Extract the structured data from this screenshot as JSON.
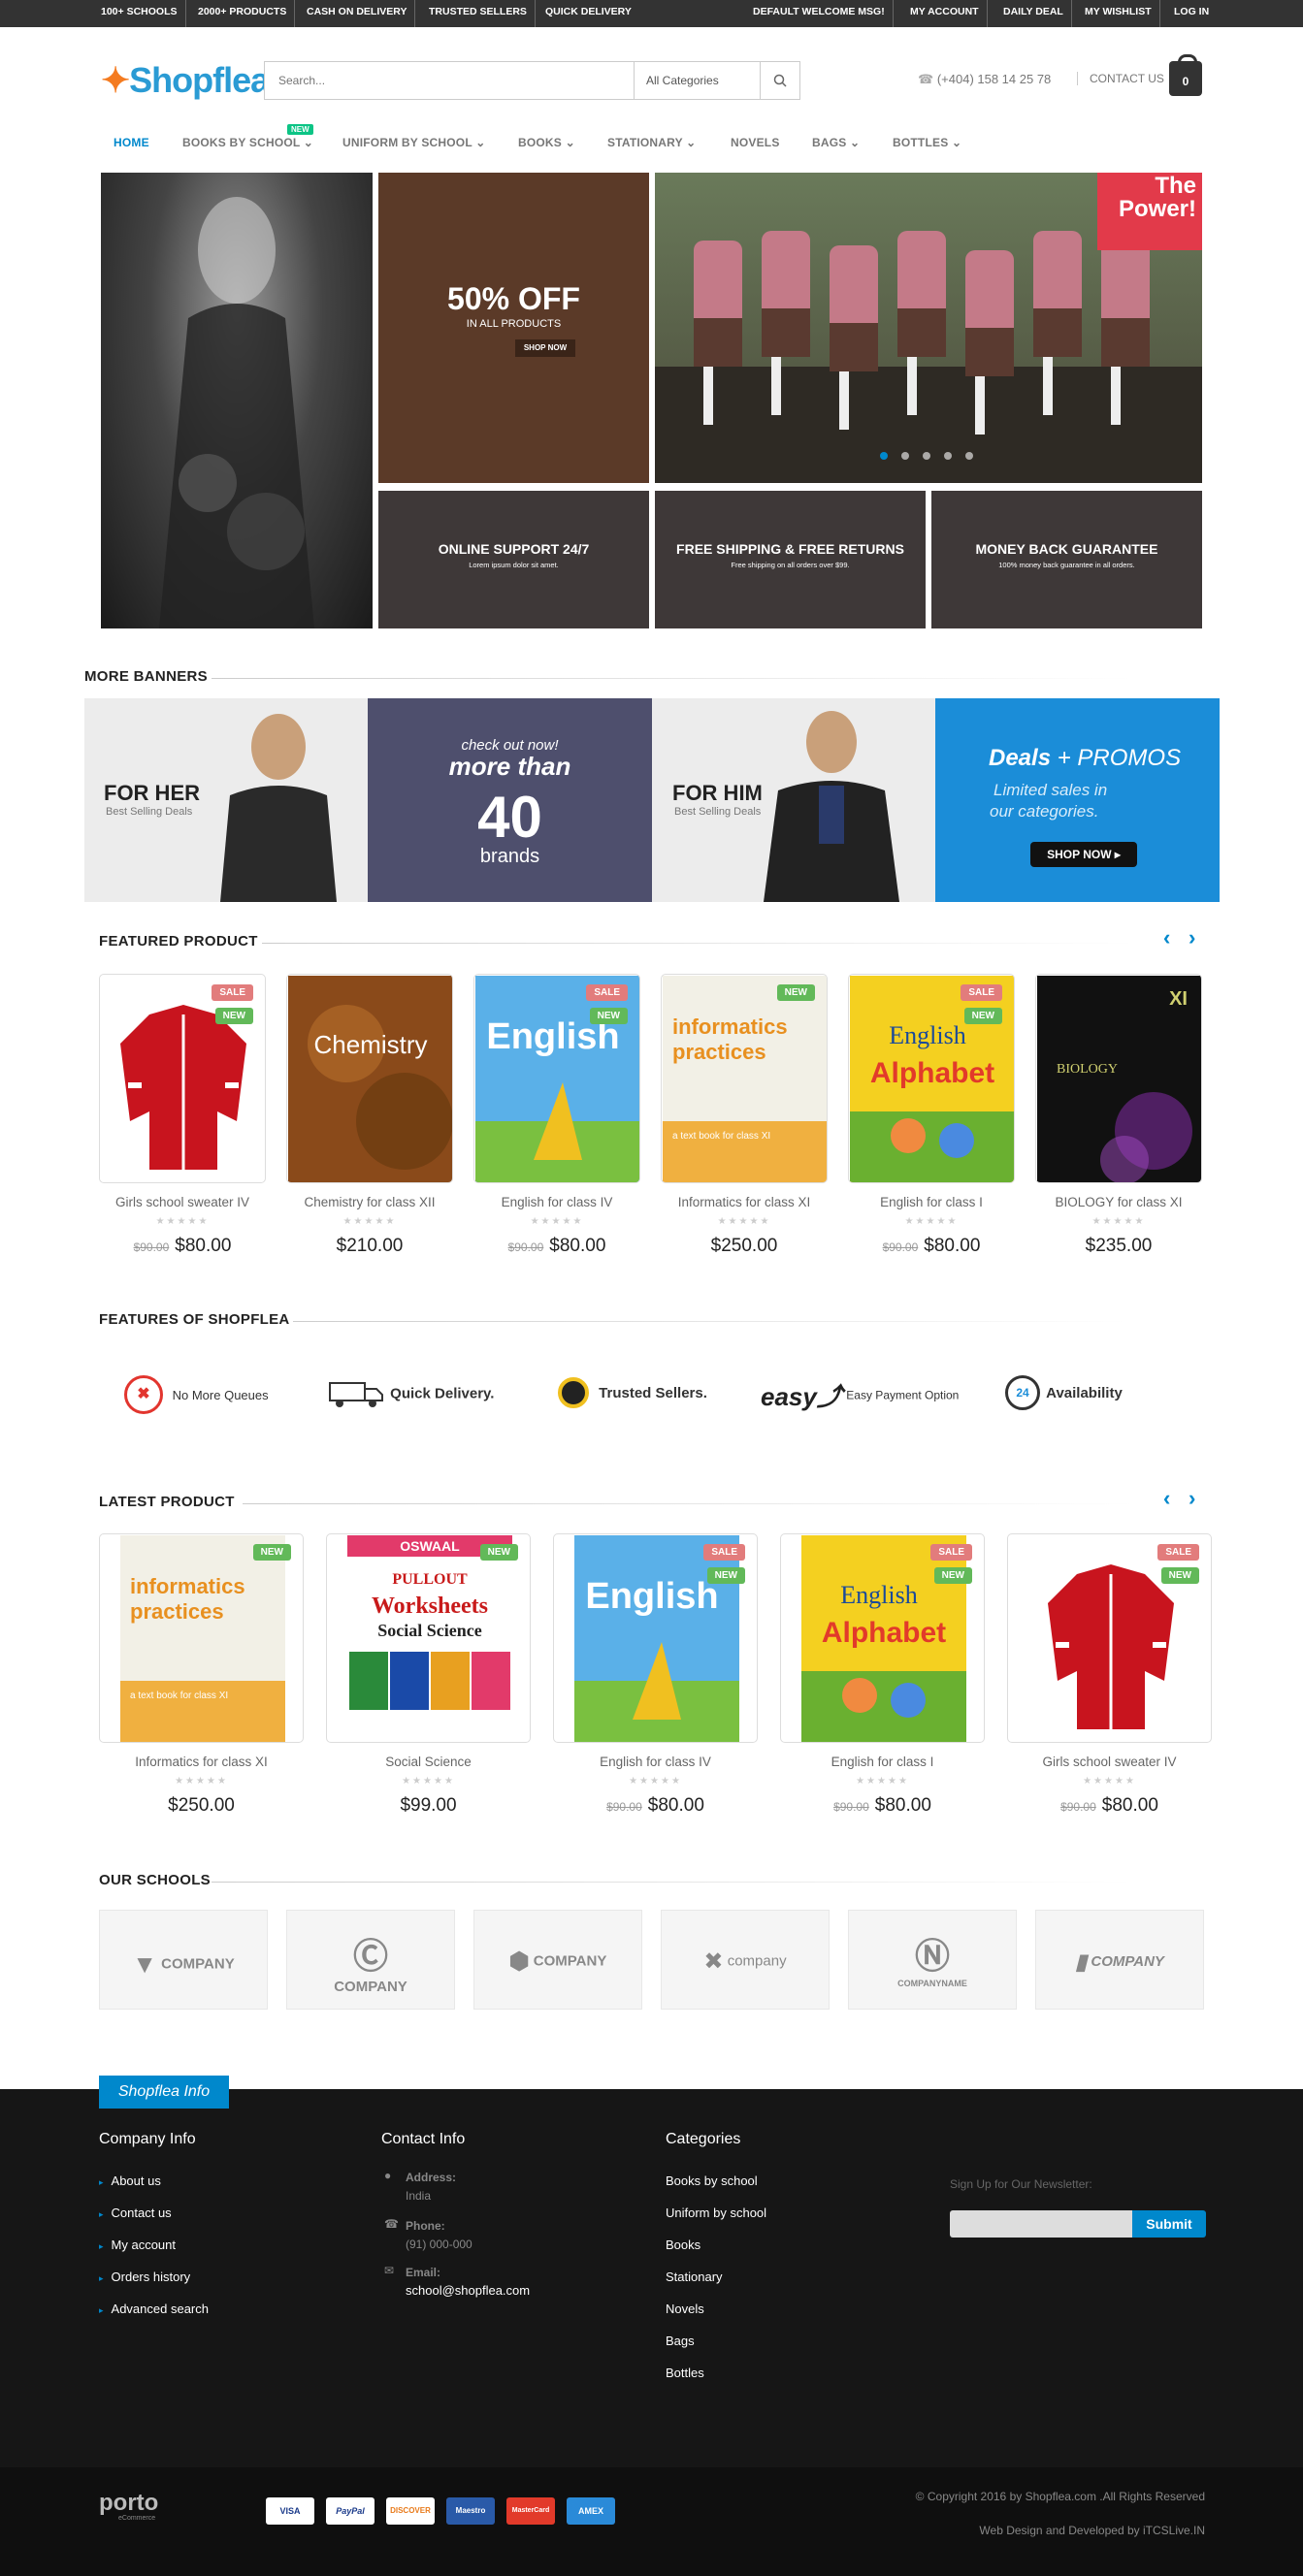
{
  "topbar": {
    "left": [
      "100+ SCHOOLS",
      "2000+ PRODUCTS",
      "CASH ON DELIVERY",
      "TRUSTED SELLERS",
      "QUICK DELIVERY"
    ],
    "right": [
      "DEFAULT WELCOME MSG!",
      "MY ACCOUNT",
      "DAILY DEAL",
      "MY WISHLIST",
      "LOG IN"
    ]
  },
  "header": {
    "logo": "Shopflea",
    "search_placeholder": "Search...",
    "category": "All Categories",
    "phone": "(+404) 158 14 25 78",
    "contact": "CONTACT US",
    "cart_count": "0"
  },
  "nav": {
    "items": [
      "HOME",
      "BOOKS BY SCHOOL",
      "UNIFORM BY SCHOOL",
      "BOOKS",
      "STATIONARY",
      "NOVELS",
      "BAGS",
      "BOTTLES"
    ],
    "new_badge": "NEW"
  },
  "hero": {
    "promo_big": "50% OFF",
    "promo_sub": "IN ALL PRODUCTS",
    "promo_btn": "SHOP NOW",
    "slider_tag": "The Power!",
    "features": [
      {
        "title": "ONLINE SUPPORT 24/7",
        "sub": "Lorem ipsum dolor sit amet."
      },
      {
        "title": "FREE SHIPPING & FREE RETURNS",
        "sub": "Free shipping on all orders over $99."
      },
      {
        "title": "MONEY BACK GUARANTEE",
        "sub": "100% money back guarantee in all orders."
      }
    ]
  },
  "more_banners": {
    "heading": "MORE BANNERS",
    "her_title": "FOR HER",
    "her_sub": "Best Selling Deals",
    "brands_line1": "check out now!",
    "brands_line2": "more than",
    "brands_num": "40",
    "brands_line3": "brands",
    "him_title": "FOR HIM",
    "him_sub": "Best Selling Deals",
    "deals_title": "Deals",
    "deals_plus": "+ PROMOS",
    "deals_sub1": "Limited sales in",
    "deals_sub2": "our categories.",
    "deals_btn": "SHOP NOW"
  },
  "featured": {
    "heading": "FEATURED PRODUCT",
    "products": [
      {
        "name": "Girls school sweater IV",
        "old": "$90.00",
        "price": "$80.00",
        "badges": [
          "SALE",
          "NEW"
        ]
      },
      {
        "name": "Chemistry for class XII",
        "old": "",
        "price": "$210.00",
        "badges": []
      },
      {
        "name": "English for class IV",
        "old": "$90.00",
        "price": "$80.00",
        "badges": [
          "SALE",
          "NEW"
        ]
      },
      {
        "name": "Informatics for class XI",
        "old": "",
        "price": "$250.00",
        "badges": [
          "NEW"
        ]
      },
      {
        "name": "English for class I",
        "old": "$90.00",
        "price": "$80.00",
        "badges": [
          "SALE",
          "NEW"
        ]
      },
      {
        "name": "BIOLOGY for class XI",
        "old": "",
        "price": "$235.00",
        "badges": []
      }
    ]
  },
  "features_section": {
    "heading": "FEATURES OF SHOPFLEA",
    "items": [
      "No More Queues",
      "Quick Delivery.",
      "Trusted Sellers.",
      "Easy Payment Option",
      "Availability"
    ]
  },
  "latest": {
    "heading": "LATEST PRODUCT",
    "products": [
      {
        "name": "Informatics for class XI",
        "old": "",
        "price": "$250.00",
        "badges": [
          "NEW"
        ]
      },
      {
        "name": "Social Science",
        "old": "",
        "price": "$99.00",
        "badges": [
          "NEW"
        ]
      },
      {
        "name": "English for class IV",
        "old": "$90.00",
        "price": "$80.00",
        "badges": [
          "SALE",
          "NEW"
        ]
      },
      {
        "name": "English for class I",
        "old": "$90.00",
        "price": "$80.00",
        "badges": [
          "SALE",
          "NEW"
        ]
      },
      {
        "name": "Girls school sweater IV",
        "old": "$90.00",
        "price": "$80.00",
        "badges": [
          "SALE",
          "NEW"
        ]
      }
    ]
  },
  "schools": {
    "heading": "OUR SCHOOLS",
    "logos": [
      "COMPANY",
      "COMPANY",
      "COMPANY",
      "company",
      "COMPANYNAME",
      "COMPANY"
    ]
  },
  "footer": {
    "tab": "Shopflea Info",
    "company_heading": "Company Info",
    "company_links": [
      "About us",
      "Contact us",
      "My account",
      "Orders history",
      "Advanced search"
    ],
    "contact_heading": "Contact Info",
    "address_label": "Address:",
    "address_value": "India",
    "phone_label": "Phone:",
    "phone_value": "(91) 000-000",
    "email_label": "Email:",
    "email_value": "school@shopflea.com",
    "categories_heading": "Categories",
    "categories": [
      "Books by school",
      "Uniform by school",
      "Books",
      "Stationary",
      "Novels",
      "Bags",
      "Bottles"
    ],
    "newsletter_label": "Sign Up for Our Newsletter:",
    "submit": "Submit",
    "porto": "porto",
    "porto_sub": "eCommerce",
    "payments": [
      "VISA",
      "PayPal",
      "DISCOVER",
      "Maestro",
      "MasterCard",
      "AMEX"
    ],
    "copyright": "© Copyright 2016 by Shopflea.com .All Rights Reserved",
    "credit": "Web Design and Developed by iTCSLive.IN"
  },
  "colors": {
    "accent": "#0088cc",
    "topbar": "#333333",
    "footer": "#161616",
    "sale": "#e27c7c",
    "new": "#62b959"
  }
}
